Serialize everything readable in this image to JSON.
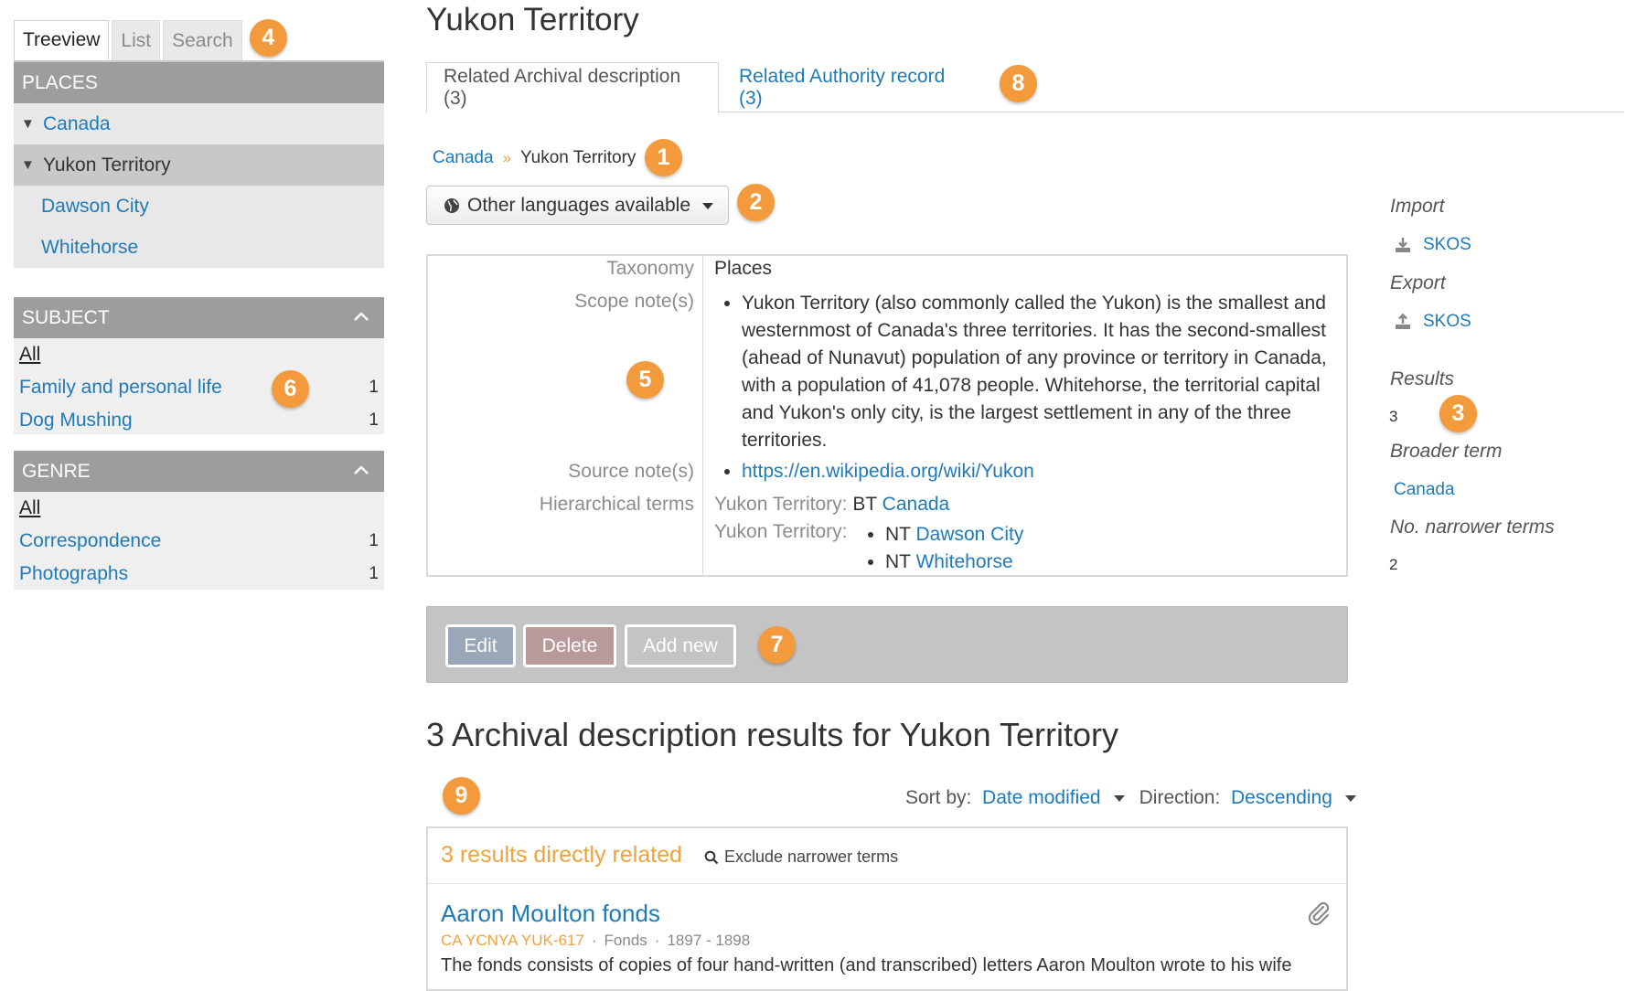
{
  "page_title": "Yukon Territory",
  "sidebar": {
    "tabs": [
      "Treeview",
      "List",
      "Search"
    ],
    "places": {
      "heading": "PLACES",
      "items": [
        {
          "label": "Canada"
        },
        {
          "label": "Yukon Territory"
        },
        {
          "label": "Dawson City"
        },
        {
          "label": "Whitehorse"
        }
      ]
    },
    "subject": {
      "heading": "SUBJECT",
      "all": "All",
      "items": [
        {
          "label": "Family and personal life",
          "count": "1"
        },
        {
          "label": "Dog Mushing",
          "count": "1"
        }
      ]
    },
    "genre": {
      "heading": "GENRE",
      "all": "All",
      "items": [
        {
          "label": "Correspondence",
          "count": "1"
        },
        {
          "label": "Photographs",
          "count": "1"
        }
      ]
    }
  },
  "tabs": {
    "archival": "Related Archival description (3)",
    "authority": "Related Authority record (3)"
  },
  "breadcrumb": {
    "parent": "Canada",
    "sep": "»",
    "current": "Yukon Territory"
  },
  "language_button": "Other languages available",
  "fields": {
    "taxonomy_label": "Taxonomy",
    "taxonomy_value": "Places",
    "scope_label": "Scope note(s)",
    "scope_value": "Yukon Territory (also commonly called the Yukon) is the smallest and westernmost of Canada's three territories. It has the second-smallest (ahead of Nunavut) population of any province or territory in Canada, with a population of 41,078 people. Whitehorse, the territorial capital and Yukon's only city, is the largest settlement in any of the three territories.",
    "source_label": "Source note(s)",
    "source_value": "https://en.wikipedia.org/wiki/Yukon",
    "hier_label": "Hierarchical terms",
    "hier_term": "Yukon Territory:",
    "bt_prefix": "BT",
    "bt_value": "Canada",
    "nt_prefix": "NT",
    "nt_values": [
      "Dawson City",
      "Whitehorse"
    ]
  },
  "actions": {
    "edit": "Edit",
    "delete": "Delete",
    "add": "Add new"
  },
  "results": {
    "title": "3 Archival description results for Yukon Territory",
    "sort_label": "Sort by:",
    "sort_value": "Date modified",
    "direction_label": "Direction:",
    "direction_value": "Descending",
    "direct_count": "3 results directly related",
    "exclude_label": "Exclude narrower terms",
    "item": {
      "title": "Aaron Moulton fonds",
      "ref": "CA YCNYA YUK-617",
      "level": "Fonds",
      "dates": "1897 - 1898",
      "dot": "·",
      "description": "The fonds consists of copies of four hand-written (and transcribed) letters Aaron Moulton wrote to his wife"
    }
  },
  "right_panel": {
    "import_label": "Import",
    "import_link": "SKOS",
    "export_label": "Export",
    "export_link": "SKOS",
    "results_label": "Results",
    "results_value": "3",
    "broader_label": "Broader term",
    "broader_value": "Canada",
    "narrower_label": "No. narrower terms",
    "narrower_value": "2"
  },
  "badges": [
    "1",
    "2",
    "3",
    "4",
    "5",
    "6",
    "7",
    "8",
    "9"
  ],
  "colors": {
    "accent": "#f39b3c",
    "link": "#1f7ab8",
    "panel": "#9d9d9d"
  }
}
